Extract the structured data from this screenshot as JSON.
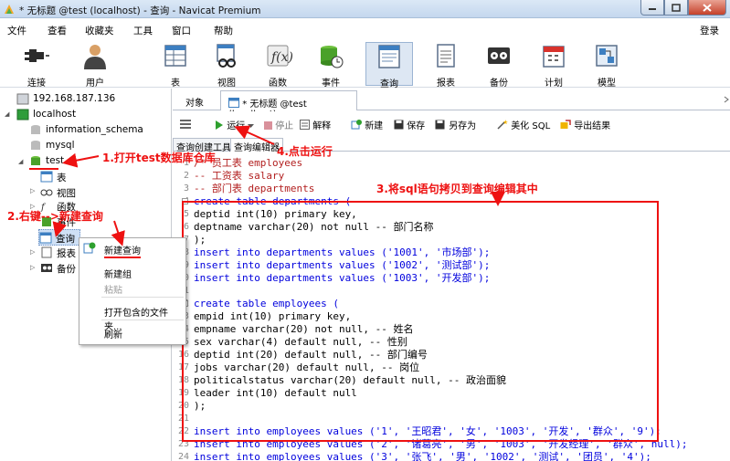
{
  "window": {
    "title": "* 无标题 @test (localhost) - 查询 - Navicat Premium"
  },
  "menu": {
    "items": [
      "文件",
      "查看",
      "收藏夹",
      "工具",
      "窗口",
      "帮助"
    ],
    "login": "登录"
  },
  "toolbar": {
    "buttons": [
      {
        "label": "连接",
        "icon": "plug-icon"
      },
      {
        "label": "用户",
        "icon": "user-icon"
      },
      {
        "label": "表",
        "icon": "table-icon"
      },
      {
        "label": "视图",
        "icon": "view-icon"
      },
      {
        "label": "函数",
        "icon": "function-icon"
      },
      {
        "label": "事件",
        "icon": "event-icon"
      },
      {
        "label": "查询",
        "icon": "query-icon"
      },
      {
        "label": "报表",
        "icon": "report-icon"
      },
      {
        "label": "备份",
        "icon": "backup-icon"
      },
      {
        "label": "计划",
        "icon": "schedule-icon"
      },
      {
        "label": "模型",
        "icon": "model-icon"
      }
    ]
  },
  "tree": {
    "host": "192.168.187.136",
    "localhost": "localhost",
    "dbs": [
      "information_schema",
      "mysql",
      "test"
    ],
    "children": [
      "表",
      "视图",
      "函数",
      "事件",
      "查询",
      "报表",
      "备份"
    ]
  },
  "tabs": {
    "object": "对象",
    "query": "* 无标题 @test (localhost) - ..."
  },
  "query_toolbar": {
    "run": "运行",
    "stop": "停止",
    "explain": "解释",
    "new": "新建",
    "save": "保存",
    "save_as": "另存为",
    "beautify": "美化 SQL",
    "export": "导出结果"
  },
  "subtabs": {
    "builder": "查询创建工具",
    "editor": "查询编辑器"
  },
  "context_menu": {
    "new_query": "新建查询",
    "new_group": "新建组",
    "paste": "粘贴",
    "open_folder": "打开包含的文件夹...",
    "refresh": "刷新"
  },
  "annotations": {
    "a1": "1.打开test数据库仓库",
    "a2": "2.右键-->新建查询",
    "a3": "3.将sql语句拷贝到查询编辑其中",
    "a4": "4.点击运行"
  },
  "editor": {
    "line_numbers": [
      "1",
      "2",
      "3",
      "4",
      "5",
      "6",
      "7",
      "8",
      "9",
      "10",
      "11",
      "12",
      "13",
      "14",
      "15",
      "16",
      "17",
      "18",
      "19",
      "20",
      "21",
      "22",
      "23",
      "24"
    ],
    "lines": [
      "/* 员工表 employees",
      "-- 工资表 salary",
      "-- 部门表 departments",
      "create table departments (",
      "deptid int(10) primary key,",
      "deptname varchar(20) not null -- 部门名称",
      ");",
      "insert into departments values ('1001', '市场部');",
      "insert into departments values ('1002', '测试部');",
      "insert into departments values ('1003', '开发部');",
      "",
      "create table employees (",
      "empid int(10) primary key,",
      "empname varchar(20) not null, -- 姓名",
      "sex varchar(4) default null, -- 性别",
      "deptid int(20) default null, -- 部门编号",
      "jobs varchar(20) default null, -- 岗位",
      "politicalstatus varchar(20) default null, -- 政治面貌",
      "leader int(10) default null",
      ");",
      "",
      "insert into employees values ('1', '王昭君', '女', '1003', '开发', '群众', '9');",
      "insert into employees values ('2', '诸葛亮', '男', '1003', '开发经理', '群众', null);",
      "insert into employees values ('3', '张飞', '男', '1002', '测试', '团员', '4');"
    ]
  },
  "colors": {
    "accent_red": "#ee1111",
    "keyword": "#0000dd",
    "type": "#7a2fb5",
    "comment": "#b21f1f"
  }
}
